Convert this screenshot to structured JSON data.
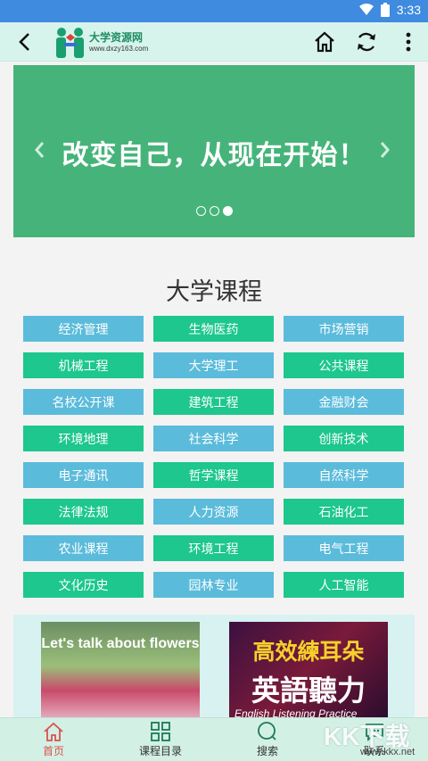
{
  "status": {
    "time": "3:33"
  },
  "header": {
    "logo_title": "大学资源网",
    "logo_url": "www.dxzy163.com"
  },
  "banner": {
    "text": "改变自己，从现在开始！",
    "slides": 3,
    "active_slide": 3
  },
  "section": {
    "title": "大学课程"
  },
  "courses": [
    [
      "经济管理",
      "生物医药",
      "市场营销"
    ],
    [
      "机械工程",
      "大学理工",
      "公共课程"
    ],
    [
      "名校公开课",
      "建筑工程",
      "金融财会"
    ],
    [
      "环境地理",
      "社会科学",
      "创新技术"
    ],
    [
      "电子通讯",
      "哲学课程",
      "自然科学"
    ],
    [
      "法律法规",
      "人力资源",
      "石油化工"
    ],
    [
      "农业课程",
      "环境工程",
      "电气工程"
    ],
    [
      "文化历史",
      "园林专业",
      "人工智能"
    ]
  ],
  "promo": {
    "flowers_text": "Let's talk about flowers",
    "english_line1": "高效練耳朵",
    "english_line2": "英語聽力",
    "english_line3": "English Listening Practice"
  },
  "bottom_nav": {
    "home": "首页",
    "catalog": "课程目录",
    "search": "搜索",
    "contact": "联系"
  },
  "watermark": {
    "main": "KK下载",
    "sub": "www.kkx.net"
  },
  "colors": {
    "status_bar": "#3e8be0",
    "toolbar": "#d7f4ec",
    "banner": "#46b47a",
    "course_blue": "#5bbbdb",
    "course_green": "#1dc78e",
    "nav_active": "#d9534f"
  }
}
